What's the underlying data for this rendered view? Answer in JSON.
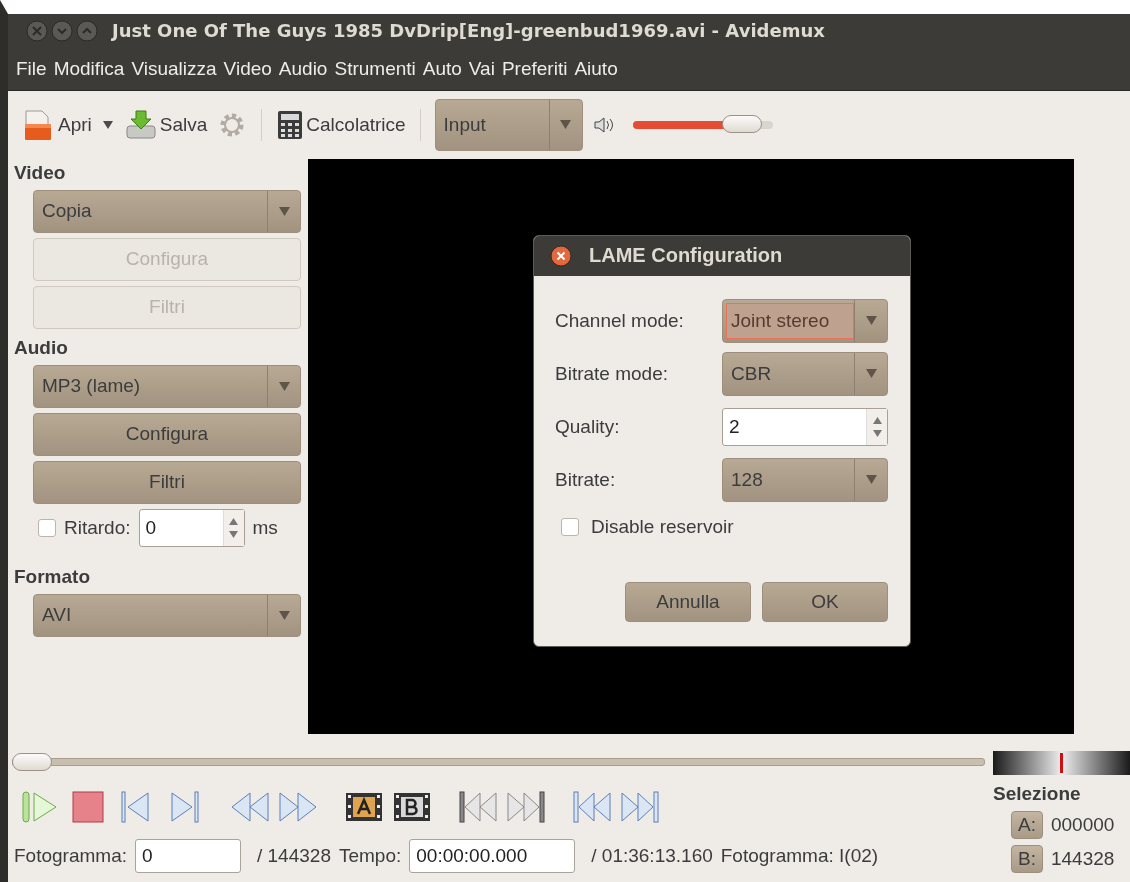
{
  "window": {
    "title": "Just One Of The Guys 1985 DvDrip[Eng]-greenbud1969.avi - Avidemux"
  },
  "menu": [
    "File",
    "Modifica",
    "Visualizza",
    "Video",
    "Audio",
    "Strumenti",
    "Auto",
    "Vai",
    "Preferiti",
    "Aiuto"
  ],
  "toolbar": {
    "open": "Apri",
    "save": "Salva",
    "calculator": "Calcolatrice",
    "view": "Input",
    "volume": {
      "level": 0.78
    }
  },
  "video": {
    "heading": "Video",
    "codec": "Copia",
    "configure": {
      "label": "Configura",
      "disabled": true
    },
    "filters": {
      "label": "Filtri",
      "disabled": true
    }
  },
  "audio": {
    "heading": "Audio",
    "codec": "MP3 (lame)",
    "configure": {
      "label": "Configura",
      "disabled": false
    },
    "filters": {
      "label": "Filtri",
      "disabled": false
    },
    "delay": {
      "label": "Ritardo:",
      "checked": false,
      "value": "0",
      "unit": "ms"
    }
  },
  "format": {
    "heading": "Formato",
    "container": "AVI"
  },
  "dialog": {
    "title": "LAME Configuration",
    "fields": [
      {
        "kind": "select",
        "label": "Channel mode:",
        "value": "Joint stereo",
        "focused": true
      },
      {
        "kind": "select",
        "label": "Bitrate mode:",
        "value": "CBR",
        "focused": false
      },
      {
        "kind": "spin",
        "label": "Quality:",
        "value": "2",
        "focused": false
      },
      {
        "kind": "select",
        "label": "Bitrate:",
        "value": "128",
        "focused": false
      }
    ],
    "reservoir": {
      "label": "Disable reservoir",
      "checked": false
    },
    "buttons": [
      "Annulla",
      "OK"
    ]
  },
  "position": {
    "level": 0
  },
  "transport": [
    {
      "kind": "play"
    },
    {
      "kind": "stop"
    },
    {
      "kind": "prev-frame"
    },
    {
      "kind": "next-frame"
    },
    {
      "kind": "rewind"
    },
    {
      "kind": "forward"
    },
    {
      "kind": "mark-a"
    },
    {
      "kind": "mark-b"
    },
    {
      "kind": "prev-black"
    },
    {
      "kind": "next-black"
    },
    {
      "kind": "first"
    },
    {
      "kind": "last"
    }
  ],
  "status": {
    "frame_label": "Fotogramma:",
    "frame": "0",
    "frame_total": "/ 144328",
    "time_label": "Tempo:",
    "time": "00:00:00.000",
    "duration": "/ 01:36:13.160",
    "frame_type": "Fotogramma: I(02)"
  },
  "selection": {
    "title": "Selezione",
    "a_label": "A:",
    "a": "000000",
    "b_label": "B:",
    "b": "144328"
  }
}
